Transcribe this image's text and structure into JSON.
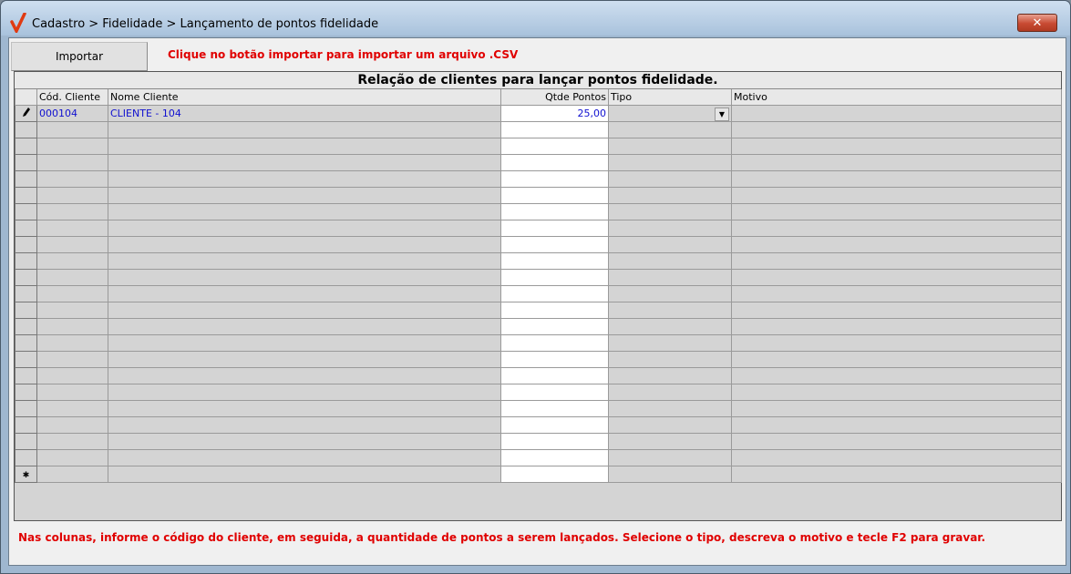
{
  "window": {
    "title": "Cadastro > Fidelidade > Lançamento de pontos fidelidade",
    "close_label": "✕",
    "accent_color": "#e03a12"
  },
  "toolbar": {
    "import_label": "Importar",
    "hint": "Clique no botão importar para importar um arquivo .CSV"
  },
  "grid": {
    "caption": "Relação de clientes para lançar pontos fidelidade.",
    "columns": [
      "Cód. Cliente",
      "Nome Cliente",
      "Qtde Pontos",
      "Tipo",
      "Motivo"
    ],
    "rows": [
      {
        "codigo": "000104",
        "nome": "CLIENTE - 104",
        "pontos": "25,00",
        "tipo": "",
        "motivo": ""
      }
    ],
    "empty_rows": 22,
    "edit_row_icon": "pencil-icon",
    "new_row_icon": "asterisk-icon"
  },
  "footer": {
    "hint": "Nas colunas, informe o código do cliente, em seguida, a quantidade de pontos a serem lançados. Selecione o tipo, descreva o motivo e tecle F2 para gravar."
  }
}
